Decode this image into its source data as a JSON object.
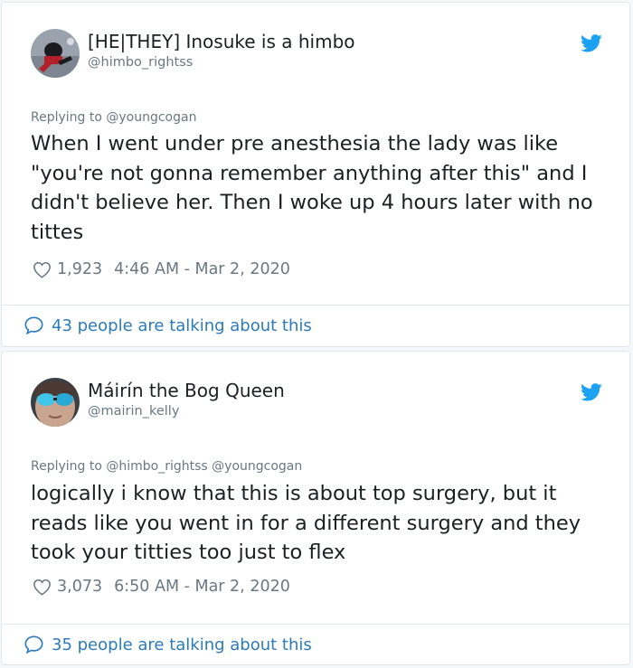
{
  "colors": {
    "link": "#2b7bb9",
    "twitter_blue": "#1da1f2",
    "muted": "#697882",
    "text": "#1c2022"
  },
  "tweets": [
    {
      "display_name": "[HE|THEY] Inosuke is a himbo",
      "handle": "@himbo_rightss",
      "replying_to": "Replying to @youngcogan",
      "text": "When I went under pre anesthesia the lady was like \"you're not gonna remember anything after this\" and I didn't believe her. Then I woke up 4 hours later with no tittes",
      "likes": "1,923",
      "timestamp": "4:46 AM - Mar 2, 2020",
      "talking": "43 people are talking about this",
      "icons": [
        "heart-icon",
        "comment-bubble-icon",
        "twitter-bird-icon"
      ]
    },
    {
      "display_name": "Máirín the Bog Queen",
      "handle": "@mairin_kelly",
      "replying_to": "Replying to @himbo_rightss @youngcogan",
      "text": "logically i know that this is about top surgery, but it reads like you went in for a different surgery and they took your titties too just to flex",
      "likes": "3,073",
      "timestamp": "6:50 AM - Mar 2, 2020",
      "talking": "35 people are talking about this",
      "icons": [
        "heart-icon",
        "comment-bubble-icon",
        "twitter-bird-icon"
      ]
    }
  ]
}
